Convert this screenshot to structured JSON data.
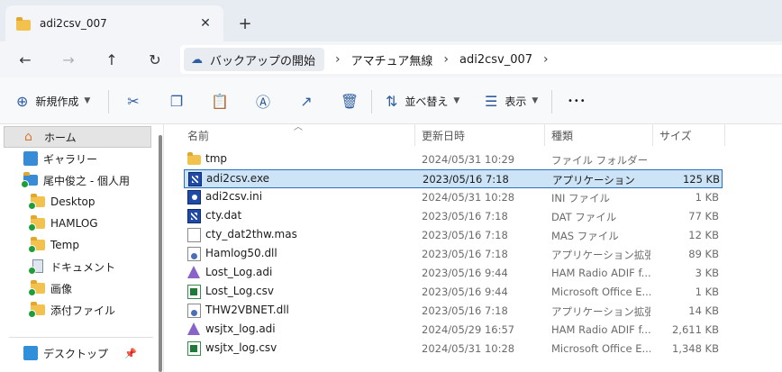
{
  "tab": {
    "title": "adi2csv_007",
    "close": "✕",
    "new": "+"
  },
  "nav": {
    "back": "←",
    "forward": "→",
    "up": "↑",
    "refresh": "↻",
    "breadcrumbs": [
      "バックアップの開始",
      "アマチュア無線",
      "adi2csv_007"
    ],
    "sep": "›"
  },
  "toolbar": {
    "new_label": "新規作成",
    "sort_label": "並べ替え",
    "view_label": "表示",
    "more": "•••"
  },
  "sidebar": {
    "items": [
      {
        "label": "ホーム",
        "icon": "home-icon"
      },
      {
        "label": "ギャラリー",
        "icon": "gallery-icon"
      },
      {
        "label": "尾中俊之 - 個人用",
        "icon": "onedrive-icon"
      },
      {
        "label": "Desktop",
        "icon": "folder-icon"
      },
      {
        "label": "HAMLOG",
        "icon": "folder-icon"
      },
      {
        "label": "Temp",
        "icon": "folder-icon"
      },
      {
        "label": "ドキュメント",
        "icon": "documents-icon"
      },
      {
        "label": "画像",
        "icon": "folder-icon"
      },
      {
        "label": "添付ファイル",
        "icon": "folder-icon"
      },
      {
        "label": "デスクトップ",
        "icon": "desktop-icon"
      }
    ]
  },
  "columns": {
    "name": "名前",
    "date": "更新日時",
    "type": "種類",
    "size": "サイズ"
  },
  "files": [
    {
      "name": "tmp",
      "date": "2024/05/31 10:29",
      "type": "ファイル フォルダー",
      "size": "",
      "icon": "folder"
    },
    {
      "name": "adi2csv.exe",
      "date": "2023/05/16 7:18",
      "type": "アプリケーション",
      "size": "125 KB",
      "icon": "exe"
    },
    {
      "name": "adi2csv.ini",
      "date": "2024/05/31 10:28",
      "type": "INI ファイル",
      "size": "1 KB",
      "icon": "ini"
    },
    {
      "name": "cty.dat",
      "date": "2023/05/16 7:18",
      "type": "DAT ファイル",
      "size": "77 KB",
      "icon": "exe"
    },
    {
      "name": "cty_dat2thw.mas",
      "date": "2023/05/16 7:18",
      "type": "MAS ファイル",
      "size": "12 KB",
      "icon": "doc"
    },
    {
      "name": "Hamlog50.dll",
      "date": "2023/05/16 7:18",
      "type": "アプリケーション拡張",
      "size": "89 KB",
      "icon": "gear"
    },
    {
      "name": "Lost_Log.adi",
      "date": "2023/05/16 9:44",
      "type": "HAM Radio ADIF f...",
      "size": "3 KB",
      "icon": "adi"
    },
    {
      "name": "Lost_Log.csv",
      "date": "2023/05/16 9:44",
      "type": "Microsoft Office E...",
      "size": "1 KB",
      "icon": "csv"
    },
    {
      "name": "THW2VBNET.dll",
      "date": "2023/05/16 7:18",
      "type": "アプリケーション拡張",
      "size": "14 KB",
      "icon": "gear"
    },
    {
      "name": "wsjtx_log.adi",
      "date": "2024/05/29 16:57",
      "type": "HAM Radio ADIF f...",
      "size": "2,611 KB",
      "icon": "adi"
    },
    {
      "name": "wsjtx_log.csv",
      "date": "2024/05/31 10:28",
      "type": "Microsoft Office E...",
      "size": "1,348 KB",
      "icon": "csv"
    }
  ],
  "selected_file": "adi2csv.exe",
  "colors": {
    "accent": "#2a70c2",
    "selection": "#cde4f7",
    "folder": "#f2c14e"
  }
}
